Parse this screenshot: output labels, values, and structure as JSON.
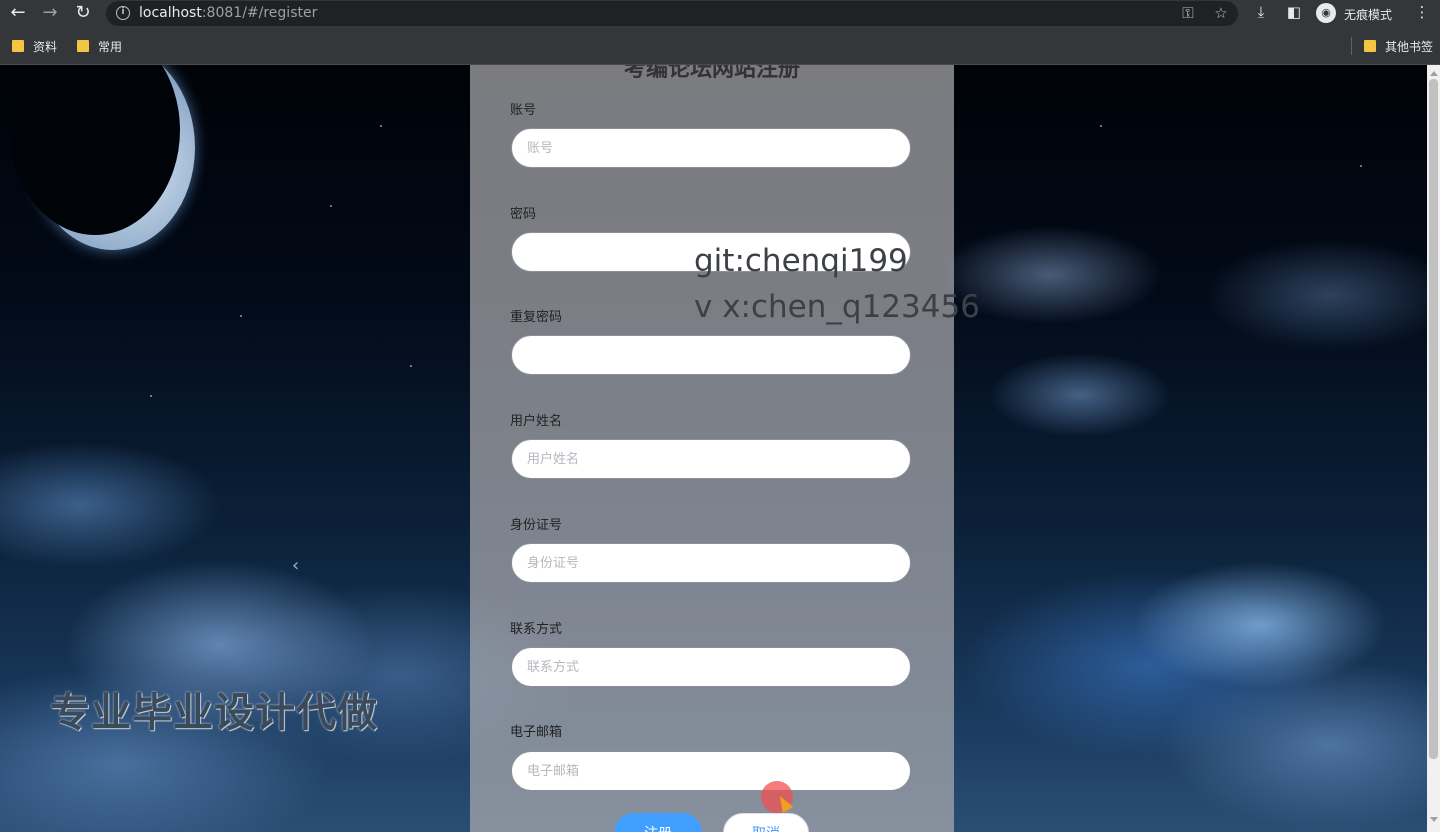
{
  "browser": {
    "url_host": "localhost",
    "url_rest": ":8081/#/register",
    "profile_label": "无痕模式",
    "bookmarks": [
      {
        "label": "资料"
      },
      {
        "label": "常用"
      }
    ],
    "other_bookmarks": "其他书签",
    "icons": {
      "back": "arrow-left-icon",
      "forward": "arrow-right-icon",
      "reload": "reload-icon",
      "info": "info-icon",
      "key": "key-icon",
      "star": "star-icon",
      "download": "download-icon",
      "side_panel": "side-panel-icon",
      "incognito": "incognito-icon",
      "menu": "kebab-menu-icon"
    }
  },
  "form": {
    "title": "考编论坛网站注册",
    "fields": [
      {
        "label": "账号",
        "placeholder": "账号",
        "value": ""
      },
      {
        "label": "密码",
        "placeholder": "",
        "value": ""
      },
      {
        "label": "重复密码",
        "placeholder": "",
        "value": ""
      },
      {
        "label": "用户姓名",
        "placeholder": "用户姓名",
        "value": ""
      },
      {
        "label": "身份证号",
        "placeholder": "身份证号",
        "value": ""
      },
      {
        "label": "联系方式",
        "placeholder": "联系方式",
        "value": ""
      },
      {
        "label": "电子邮箱",
        "placeholder": "电子邮箱",
        "value": ""
      }
    ],
    "submit_label": "注册",
    "cancel_label": "取消"
  },
  "watermark": {
    "line1": "git:chenqi199",
    "line2": "v x:chen_q123456"
  },
  "overlay_text": "专业毕业设计代做",
  "colors": {
    "primary": "#409eff",
    "chrome": "#35363a"
  }
}
